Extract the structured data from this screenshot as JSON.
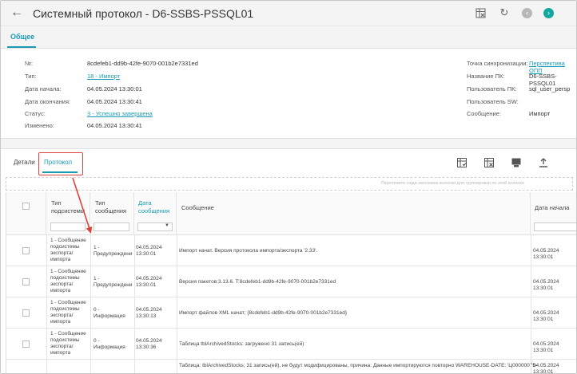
{
  "header": {
    "title": "Системный протокол - D6-SSBS-PSSQL01",
    "back_icon": "arrow-left-icon"
  },
  "tabs": {
    "general": "Общее"
  },
  "info": {
    "num_label": "№:",
    "num_value": "8cdefeb1-dd9b-42fe-9070-001b2e7331ed",
    "type_label": "Тип:",
    "type_value": "18 - Импорт",
    "start_label": "Дата начала:",
    "start_value": "04.05.2024 13:30:01",
    "end_label": "Дата окончания:",
    "end_value": "04.05.2024 13:30:41",
    "status_label": "Статус:",
    "status_value": "3 - Успешно завершена",
    "changed_label": "Изменено:",
    "changed_value": "04.05.2024 13:30:41",
    "sync_label": "Точка синхронизации:",
    "sync_value": "Перспектива ОПП",
    "pc_label": "Название ПК:",
    "pc_value": "D6-SSBS-PSSQL01",
    "pcuser_label": "Пользователь ПК:",
    "pcuser_value": "sql_user_persp",
    "swuser_label": "Пользователь SW:",
    "swuser_value": "",
    "msg_label": "Сообщение:",
    "msg_value": "Импорт"
  },
  "subtabs": {
    "details": "Детали",
    "protocol": "Протокол"
  },
  "groupbar_text": "Перетяните сюда заголовок колонки для группировки по этой колонке",
  "columns": {
    "subsystem_type": [
      "Тип",
      "подсистемы"
    ],
    "message_type": [
      "Тип",
      "сообщения"
    ],
    "message_date": [
      "Дата",
      "сообщения"
    ],
    "message": "Сообщение",
    "start_date": "Дата начала"
  },
  "rows": [
    {
      "subsystem": [
        "1 - Сообщение",
        "подсистемы",
        "экспорта/",
        "импорта"
      ],
      "msgtype": [
        "1 -",
        "Предупреждени"
      ],
      "date": [
        "04.05.2024",
        "13:30:01"
      ],
      "message": "Импорт начат. Версия протокола импорта/экспорта '2.33'.",
      "start": "04.05.2024 13:30:01"
    },
    {
      "subsystem": [
        "1 - Сообщение",
        "подсистемы",
        "экспорта/",
        "импорта"
      ],
      "msgtype": [
        "1 -",
        "Предупреждени"
      ],
      "date": [
        "04.05.2024",
        "13:30:01"
      ],
      "message": "Версия пакетов:3.13.6. T:8cdefeb1-dd9b-42fe-9070-001b2e7331ed",
      "start": "04.05.2024 13:30:01"
    },
    {
      "subsystem": [
        "1 - Сообщение",
        "подсистемы",
        "экспорта/",
        "импорта"
      ],
      "msgtype": [
        "0 -",
        "Информация"
      ],
      "date": [
        "04.05.2024",
        "13:30:13"
      ],
      "message": "Импорт файлов XML начат; {8cdefeb1-dd9b-42fe-9070-001b2e7331ed}",
      "start": "04.05.2024 13:30:01"
    },
    {
      "subsystem": [
        "1 - Сообщение",
        "подсистемы",
        "экспорта/",
        "импорта"
      ],
      "msgtype": [
        "0 -",
        "Информация"
      ],
      "date": [
        "04.05.2024",
        "13:30:36"
      ],
      "message": "Таблица tblArchivedStocks: загружено 31 запись(ей)",
      "start": "04.05.2024 13:30:01"
    },
    {
      "subsystem": [],
      "msgtype": [],
      "date": [],
      "message": "Таблица: tblArchivedStocks; 31 запись(ей), не будут модифицированы, причина: Данные импортируются повторно WAREHOUSE-DATE: 'Ц00000075-",
      "start": "04.05.2024 13:30:01"
    }
  ],
  "colors": {
    "accent": "#1a9bb5",
    "highlight": "#d9453d",
    "confirm": "#13a89e"
  }
}
